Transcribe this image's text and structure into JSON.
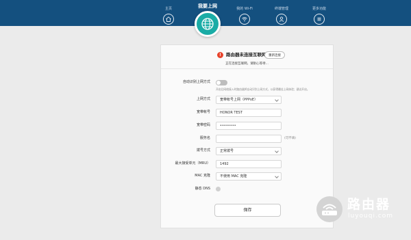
{
  "nav": {
    "items": [
      {
        "label": "主页",
        "icon": "home-icon"
      },
      {
        "label": "我要上网",
        "icon": "globe-icon"
      },
      {
        "label": "我的 Wi-Fi",
        "icon": "wifi-icon"
      },
      {
        "label": "终端管理",
        "icon": "user-icon"
      },
      {
        "label": "更多功能",
        "icon": "menu-icon"
      }
    ],
    "active_index": 1
  },
  "status": {
    "title": "路由器未连接互联网",
    "button": "重新连接",
    "subtitle": "正在连接互联网，请耐心等待..."
  },
  "form": {
    "auto_detect": {
      "label": "自动识别上网方式",
      "enabled": false,
      "hint": "开启后网络接入时路由器将自动识别上网方式，以获得最佳上网体验；建议开启。"
    },
    "connection_type": {
      "label": "上网方式",
      "value": "宽带帐号上网（PPPoE）"
    },
    "account": {
      "label": "宽带帐号",
      "value": "HONOR TEST"
    },
    "password": {
      "label": "宽带密码",
      "value": "••••••••"
    },
    "service_name": {
      "label": "服务名",
      "value": "",
      "suffix": "(可不填)"
    },
    "dial_mode": {
      "label": "拨号方式",
      "value": "正常拨号"
    },
    "mru": {
      "label": "最大接受单元（MRU）",
      "value": "1492"
    },
    "mac_clone": {
      "label": "MAC 克隆",
      "value": "不使用 MAC 克隆"
    },
    "static_dns": {
      "label": "静态 DNS",
      "enabled": false
    },
    "save": "保存"
  },
  "watermark": {
    "title": "路由器",
    "url": "luyouqi.com"
  },
  "colors": {
    "topbar": "#14507f",
    "active": "#1aaca6",
    "error": "#e8432b"
  }
}
